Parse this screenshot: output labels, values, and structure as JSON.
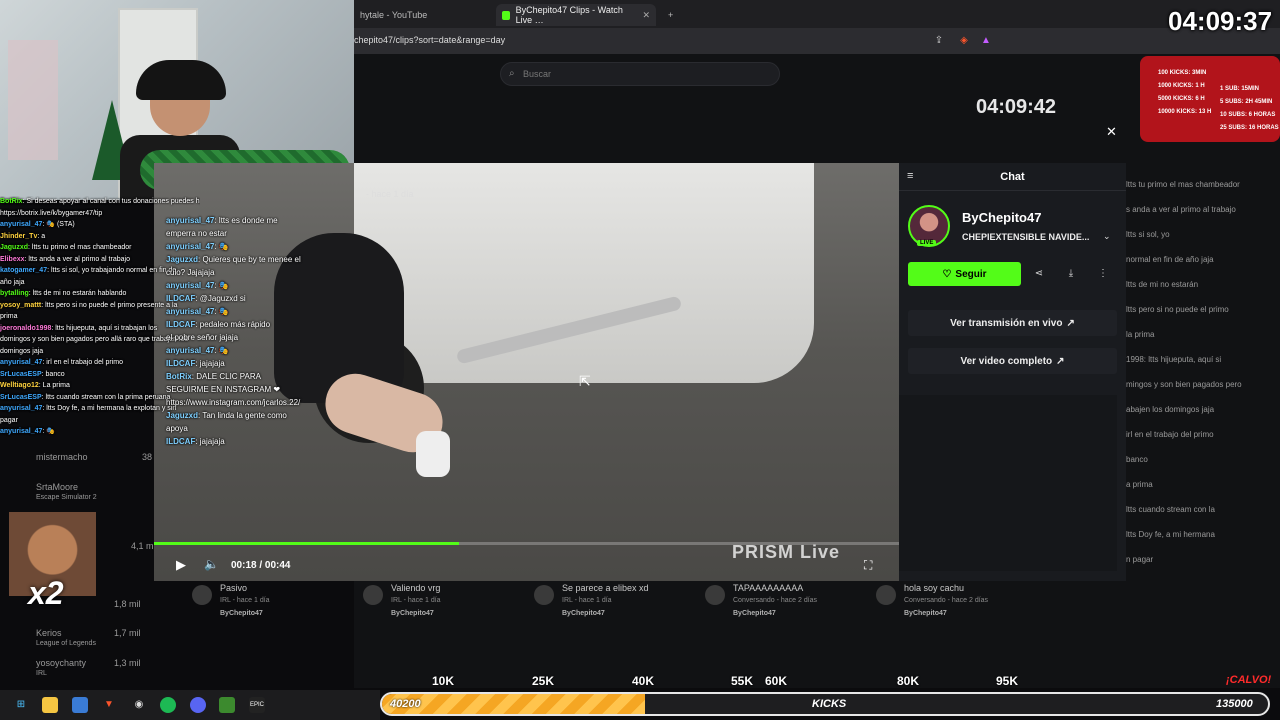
{
  "browser": {
    "tabs": [
      {
        "label": "hytale - YouTube",
        "active": false
      },
      {
        "label": "ByChepito47 Clips - Watch Live …",
        "active": true
      }
    ],
    "url": "chepito47/clips?sort=date&range=day"
  },
  "kick": {
    "search_placeholder": "Buscar",
    "clip_meta": "- hace 1 día",
    "player": {
      "progress": 0.41,
      "time": "00:18 / 00:44",
      "watermark": "PRISM Live"
    },
    "panel": {
      "title": "Chat",
      "channel": "ByChepito47",
      "stream_title": "CHEPIEXTENSIBLE NAVIDE...",
      "live_badge": "LIVE",
      "follow_label": "Seguir",
      "watch_live": "Ver transmisión en vivo",
      "watch_full": "Ver video completo"
    },
    "clips": [
      {
        "title": "Pasivo",
        "sub": "IRL - hace 1 día",
        "channel": "ByChepito47"
      },
      {
        "title": "Valiendo vrg",
        "sub": "IRL - hace 1 día",
        "channel": "ByChepito47"
      },
      {
        "title": "Se parece a elibex xd",
        "sub": "IRL - hace 1 día",
        "channel": "ByChepito47"
      },
      {
        "title": "TAPAAAAAAAAA",
        "sub": "Conversando - hace 2 días",
        "channel": "ByChepito47"
      },
      {
        "title": "hola soy cachu",
        "sub": "Conversando - hace 2 días",
        "channel": "ByChepito47"
      }
    ],
    "sidebar": [
      {
        "name": "mistermacho",
        "count": "38"
      },
      {
        "name": "SrtaMoore",
        "sub": "Escape Simulator 2",
        "count": ""
      },
      {
        "name": "",
        "count": "4,1 m"
      },
      {
        "name": "",
        "count": "1,8 mil"
      },
      {
        "name": "Kerios",
        "sub": "League of Legends",
        "count": "1,7 mil"
      },
      {
        "name": "yosoychanty",
        "sub": "IRL",
        "count": "1,3 mil"
      }
    ]
  },
  "overlay_chat": [
    {
      "user": "BotRix",
      "text": ": Si deseas apoyar al canal con tus donaciones puedes hacer con este link",
      "color": "#53fc18"
    },
    {
      "user": "",
      "text": "https://botrix.live/k/bygamer47/tip",
      "color": "#ffffff"
    },
    {
      "user": "anyurisal_47",
      "text": ": 🎭 (STA)",
      "color": "#3fa9ff"
    },
    {
      "user": "Jhinder_Tv",
      "text": ": a",
      "color": "#ffd23f"
    },
    {
      "user": "Jaguzxd",
      "text": ": ltts tu primo el mas chambeador",
      "color": "#53fc18"
    },
    {
      "user": "Elibexx",
      "text": ": ltts anda a ver al primo al trabajo",
      "color": "#ff7ad9"
    },
    {
      "user": "katogamer_47",
      "text": ": ltts si sol, yo trabajando normal en fin de",
      "color": "#3fa9ff"
    },
    {
      "user": "",
      "text": "año jaja",
      "color": "#ffffff"
    },
    {
      "user": "bytalling",
      "text": ": ltts de mi no estarán hablando",
      "color": "#53fc18"
    },
    {
      "user": "yosoy_mattt",
      "text": ": ltts pero si no puede el primo presente a la",
      "color": "#ffd23f"
    },
    {
      "user": "",
      "text": "prima",
      "color": "#ffffff"
    },
    {
      "user": "joeronaldo1998",
      "text": ": ltts hijueputa, aquí si trabajan los",
      "color": "#ff7ad9"
    },
    {
      "user": "",
      "text": "domingos y son bien pagados pero allá raro que trabajen los",
      "color": "#ffffff"
    },
    {
      "user": "",
      "text": "domingos jaja",
      "color": "#ffffff"
    },
    {
      "user": "anyurisal_47",
      "text": ": irl en el trabajo del primo",
      "color": "#3fa9ff"
    },
    {
      "user": "SrLucasESP",
      "text": ": banco",
      "color": "#3fa9ff"
    },
    {
      "user": "Welltiago12",
      "text": ": La prima",
      "color": "#ffd23f"
    },
    {
      "user": "SrLucasESP",
      "text": ": ltts cuando stream con la prima peruana",
      "color": "#3fa9ff"
    },
    {
      "user": "anyurisal_47",
      "text": ": ltts Doy fe, a mi hermana la explotan y sin",
      "color": "#3fa9ff"
    },
    {
      "user": "",
      "text": "pagar",
      "color": "#ffffff"
    },
    {
      "user": "anyurisal_47",
      "text": ": 🎭",
      "color": "#3fa9ff"
    }
  ],
  "overlay_chat2": [
    {
      "user": "anyurisal_47",
      "text": ": ltts es donde me"
    },
    {
      "user": "",
      "text": "emperra no estar"
    },
    {
      "user": "anyurisal_47",
      "text": ": 🎭"
    },
    {
      "user": "Jaguzxd",
      "text": ": Quieres que by te menee el"
    },
    {
      "user": "",
      "text": "culo? Jajajaja"
    },
    {
      "user": "anyurisal_47",
      "text": ": 🎭"
    },
    {
      "user": "ILDCAF",
      "text": ": @Jaguzxd si"
    },
    {
      "user": "anyurisal_47",
      "text": ": 🎭"
    },
    {
      "user": "ILDCAF",
      "text": ": pedaleo más rápido"
    },
    {
      "user": "",
      "text": "el pobre señor jajaja"
    },
    {
      "user": "anyurisal_47",
      "text": ": 🎭"
    },
    {
      "user": "ILDCAF",
      "text": ": jajajaja"
    },
    {
      "user": "BotRix",
      "text": ": DALE CLIC PARA"
    },
    {
      "user": "",
      "text": "SEGUIRME EN INSTAGRAM ❤"
    },
    {
      "user": "",
      "text": "https://www.instagram.com/jcarlos.22/"
    },
    {
      "user": "Jaguzxd",
      "text": ": Tan linda la gente como"
    },
    {
      "user": "",
      "text": "apoya"
    },
    {
      "user": "ILDCAF",
      "text": ": jajajaja"
    }
  ],
  "right_chat": [
    "ltts tu primo el mas chambeador",
    "s anda a ver al primo al trabajo",
    "ltts si sol, yo",
    "normal en fin de año jaja",
    "ltts de mi no estarán",
    "ltts pero si no puede el primo",
    "la prima",
    "1998: ltts hijueputa, aquí si",
    "mingos y son bien pagados pero",
    "abajen los domingos jaja",
    "irl en el trabajo del primo",
    "banco",
    "a prima",
    "ltts cuando stream con la",
    "ltts Doy fe, a mi hermana",
    "n pagar"
  ],
  "stream_overlay": {
    "clock": "04:09:37",
    "clock_inner": "04:09:42",
    "prizes_left": [
      "100 KICKS: 3MIN",
      "1000 KICKS: 1 H",
      "5000 KICKS: 6 H",
      "10000 KICKS: 13 H"
    ],
    "prizes_right": [
      "1 SUB: 15MIN",
      "5 SUBS: 2H 45MIN",
      "10 SUBS: 6 HORAS",
      "25 SUBS: 16 HORAS"
    ],
    "goal": {
      "ticks": [
        "10K",
        "25K",
        "40K",
        "55K",
        "60K",
        "80K",
        "95K"
      ],
      "current": "40200",
      "label": "KICKS",
      "target": "135000",
      "progress": 0.297,
      "shout": "¡CALVO!"
    },
    "reaction_label": "x2"
  },
  "colors": {
    "kick_green": "#53fc18",
    "goal_orange": "#f5a623",
    "prize_red": "#b2141b"
  }
}
